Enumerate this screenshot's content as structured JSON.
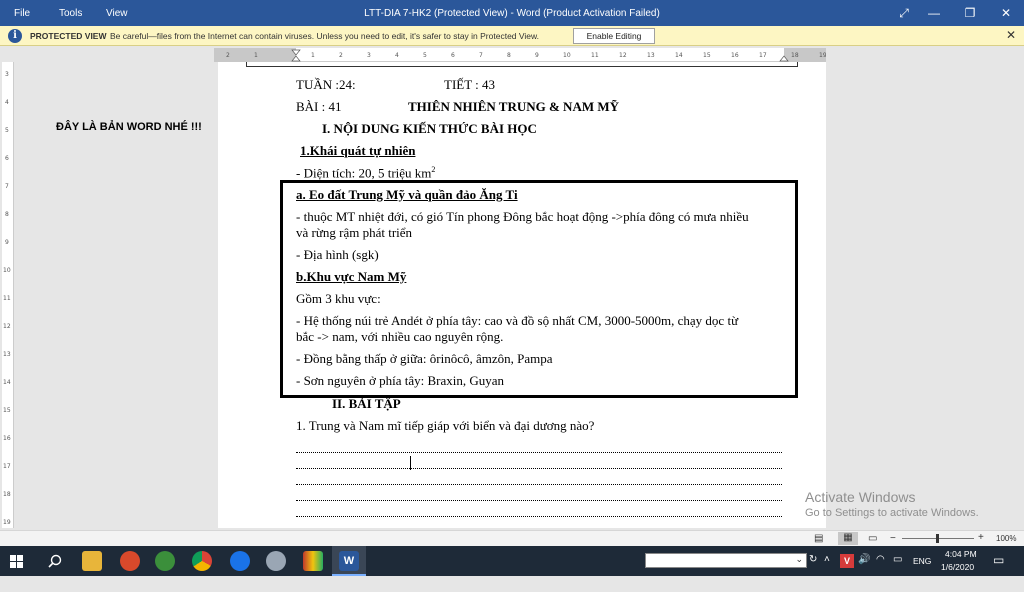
{
  "window": {
    "title": "LTT-DIA 7-HK2 (Protected View) - Word (Product Activation Failed)",
    "menu": [
      "File",
      "Tools",
      "View"
    ]
  },
  "protected_view": {
    "label": "PROTECTED VIEW",
    "message": "Be careful—files from the Internet can contain viruses. Unless you need to edit, it's safer to stay in Protected View.",
    "button": "Enable Editing"
  },
  "side_note": "ĐÂY LÀ BẢN WORD NHÉ !!!",
  "document": {
    "week": "TUẦN :24:",
    "period": "TIẾT : 43",
    "lesson": "BÀI : 41",
    "lesson_title": "THIÊN NHIÊN TRUNG & NAM MỸ",
    "section1": "I. NỘI DUNG KIẾN THỨC BÀI HỌC",
    "sub1": "1.Khái quát tự nhiên",
    "area_prefix": "- Diện tích: 20, 5 triệu km",
    "area_sup": "2",
    "a_title": "a. Eo đất Trung Mỹ và quần đảo Ăng Ti",
    "a_line1": "- thuộc MT nhiệt đới, có gió Tín phong Đông bắc hoạt động ->phía đông có mưa nhiều",
    "a_line2": "và rừng rậm phát triển",
    "a_line3": "- Địa hình (sgk)",
    "b_title": "b.Khu vực Nam Mỹ",
    "b_line1": "Gồm 3 khu vực:",
    "b_line2": "- Hệ thống núi trẻ Andét ở phía tây: cao và đồ sộ nhất CM, 3000-5000m, chạy dọc từ",
    "b_line3": "bắc -> nam, với nhiều cao nguyên rộng.",
    "b_line4": "- Đồng bằng thấp ở giữa: ôrinôcô, âmzôn, Pampa",
    "b_line5": "- Sơn nguyên ở phía tây: Braxin, Guyan",
    "section2": "II. BÀI TẬP",
    "q1": "1. Trung và Nam mĩ tiếp giáp với biển và đại dương nào?"
  },
  "activate": {
    "title": "Activate Windows",
    "subtitle": "Go to Settings to activate Windows."
  },
  "status": {
    "zoom": "100%"
  },
  "tray": {
    "lang": "ENG",
    "time": "4:04 PM",
    "date": "1/6/2020"
  }
}
